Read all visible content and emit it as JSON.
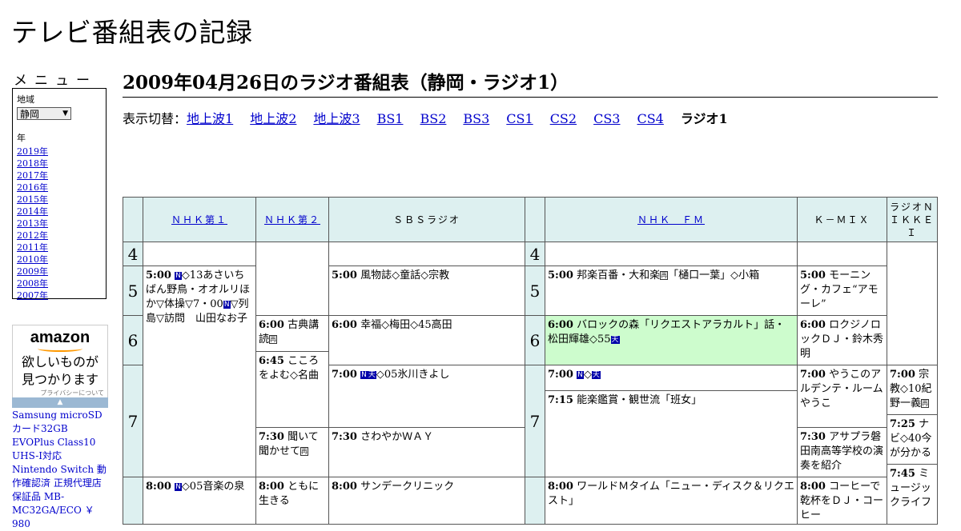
{
  "site_title": "テレビ番組表の記録",
  "menu": {
    "heading": "メニュー",
    "region_label": "地域",
    "region_value": "静岡",
    "year_label": "年",
    "years": [
      "2019年",
      "2018年",
      "2017年",
      "2016年",
      "2015年",
      "2014年",
      "2013年",
      "2012年",
      "2011年",
      "2010年",
      "2009年",
      "2008年",
      "2007年"
    ]
  },
  "ad": {
    "logo": "amazon",
    "copy_line1": "欲しいものが",
    "copy_line2": "見つかります",
    "privacy": "プライバシーについて",
    "bar": "▲",
    "product_link": "Samsung microSDカード32GB EVOPlus Class10 UHS-I対応 Nintendo Switch 動作確認済 正規代理店保証品 MB-MC32GA/ECO ￥ 980"
  },
  "page_title": "2009年04月26日のラジオ番組表（静岡・ラジオ1）",
  "switcher": {
    "label": "表示切替：",
    "links": [
      "地上波1",
      "地上波2",
      "地上波3",
      "BS1",
      "BS2",
      "BS3",
      "CS1",
      "CS2",
      "CS3",
      "CS4"
    ],
    "current": "ラジオ1"
  },
  "headers": [
    "ＮＨＫ第１",
    "ＮＨＫ第２",
    "ＳＢＳラジオ",
    "ＮＨＫ　ＦＭ",
    "Ｋ－ＭＩＸ",
    "ラジオＮＩＫＫＥＩ"
  ],
  "hours": [
    "4",
    "5",
    "6",
    "7"
  ],
  "programs": {
    "nhk1_500": {
      "time": "5:00",
      "b1": "N",
      "text": "◇13あさいちばん野鳥・オオルリほか▽体操▽7・00",
      "b2": "N",
      "text2": "▽列島▽訪問　山田なお子"
    },
    "nhk1_800": {
      "time": "8:00",
      "b1": "N",
      "text": "◇05音楽の泉"
    },
    "nhk2_600": {
      "time": "6:00",
      "text": "古典講読",
      "b": "再"
    },
    "nhk2_645": {
      "time": "6:45",
      "text": "こころをよむ◇名曲"
    },
    "nhk2_730": {
      "time": "7:30",
      "text": "聞いて聞かせて",
      "b": "再"
    },
    "nhk2_800": {
      "time": "8:00",
      "text": "ともに生きる"
    },
    "sbs_500": {
      "time": "5:00",
      "text": "風物誌◇童話◇宗教"
    },
    "sbs_600": {
      "time": "6:00",
      "text": "幸福◇梅田◇45高田"
    },
    "sbs_700": {
      "time": "7:00",
      "b1": "N",
      "b2": "天",
      "text": "◇05氷川きよし"
    },
    "sbs_730": {
      "time": "7:30",
      "text": "さわやかＷＡＹ"
    },
    "sbs_800": {
      "time": "8:00",
      "text": "サンデークリニック"
    },
    "fm_500": {
      "time": "5:00",
      "text": "邦楽百番・大和楽",
      "b": "再",
      "text2": "「樋口一葉」◇小箱"
    },
    "fm_600": {
      "time": "6:00",
      "text": "バロックの森「リクエストアラカルト」話・松田輝雄◇55",
      "b": "天"
    },
    "fm_700": {
      "time": "7:00",
      "b1": "N",
      "text": "◇",
      "b2": "天"
    },
    "fm_715": {
      "time": "7:15",
      "text": "能楽鑑賞・観世流「班女」"
    },
    "fm_800": {
      "time": "8:00",
      "text": "ワールドＭタイム「ニュー・ディスク＆リクエスト」"
    },
    "kmix_500": {
      "time": "5:00",
      "text": "モーニング・カフェ“アモーレ”"
    },
    "kmix_600": {
      "time": "6:00",
      "text": "ロクジノロックＤＪ・鈴木秀明"
    },
    "kmix_700": {
      "time": "7:00",
      "text": "やうこのアルデンテ・ルーム　やうこ"
    },
    "kmix_730": {
      "time": "7:30",
      "text": "アサプラ磐田南高等学校の演奏を紹介"
    },
    "kmix_800": {
      "time": "8:00",
      "text": "コーヒーで乾杯をＤＪ・コーヒー"
    },
    "nikkei_700": {
      "time": "7:00",
      "text": "宗教◇10紀野一義",
      "b": "再"
    },
    "nikkei_725": {
      "time": "7:25",
      "text": "ナビ◇40今が分かる"
    },
    "nikkei_745": {
      "time": "7:45",
      "text": "ミュージックライフ"
    }
  },
  "colors": {
    "header_bg": "#ddf0f0",
    "highlight_bg": "#cdfccd",
    "link": "#0000cc"
  }
}
